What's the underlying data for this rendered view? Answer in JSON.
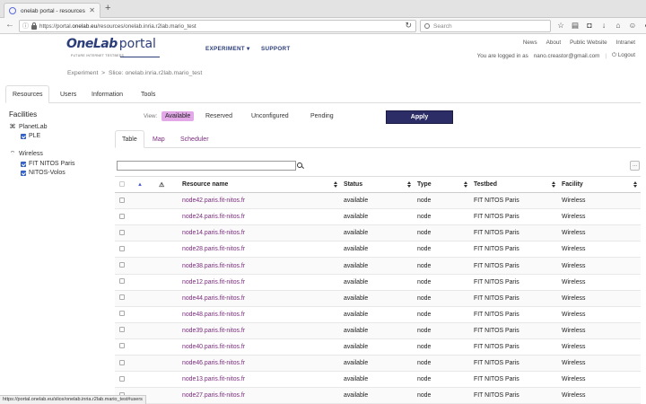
{
  "browser": {
    "tab_title": "onelab portal - resources",
    "url_scheme": "https://portal.",
    "url_domain": "onelab.eu",
    "url_path": "/resources/onelab.inria.r2lab.mario_test",
    "search_placeholder": "Search",
    "status_url": "https://portal.onelab.eu/slice/onelab.inria.r2lab.mario_test#users"
  },
  "header": {
    "logo_main": "OneLab",
    "logo_sub": "portal",
    "logo_tagline": "FUTURE INTERNET TESTBEDS",
    "menu_experiment": "EXPERIMENT",
    "menu_support": "SUPPORT",
    "links": [
      "News",
      "About",
      "Public Website",
      "Intranet"
    ],
    "logged_in_label": "You are logged in as",
    "user_email": "nano.creastor@gmail.com",
    "logout_label": "Logout"
  },
  "breadcrumb": {
    "root": "Experiment",
    "separator": ">",
    "current": "Slice: onelab.inria.r2lab.mario_test"
  },
  "page_tabs": [
    "Resources",
    "Users",
    "Information",
    "Tools"
  ],
  "facilities": {
    "title": "Facilities",
    "groups": [
      {
        "name": "PlanetLab",
        "icon": "planetlab-icon",
        "items": [
          {
            "label": "PLE",
            "checked": true
          }
        ]
      },
      {
        "name": "Wireless",
        "icon": "wifi-icon",
        "items": [
          {
            "label": "FIT NITOS Paris",
            "checked": true
          },
          {
            "label": "NITOS-Volos",
            "checked": true
          }
        ]
      }
    ]
  },
  "view": {
    "label": "View:",
    "options": [
      "Available",
      "Reserved",
      "Unconfigured",
      "Pending"
    ],
    "active": "Available",
    "apply_label": "Apply"
  },
  "sub_tabs": [
    "Table",
    "Map",
    "Scheduler"
  ],
  "table": {
    "more_label": "...",
    "columns": [
      "Resource name",
      "Status",
      "Type",
      "Testbed",
      "Facility"
    ],
    "rows": [
      [
        "node42.paris.fit-nitos.fr",
        "available",
        "node",
        "FIT NITOS Paris",
        "Wireless"
      ],
      [
        "node24.paris.fit-nitos.fr",
        "available",
        "node",
        "FIT NITOS Paris",
        "Wireless"
      ],
      [
        "node14.paris.fit-nitos.fr",
        "available",
        "node",
        "FIT NITOS Paris",
        "Wireless"
      ],
      [
        "node28.paris.fit-nitos.fr",
        "available",
        "node",
        "FIT NITOS Paris",
        "Wireless"
      ],
      [
        "node38.paris.fit-nitos.fr",
        "available",
        "node",
        "FIT NITOS Paris",
        "Wireless"
      ],
      [
        "node12.paris.fit-nitos.fr",
        "available",
        "node",
        "FIT NITOS Paris",
        "Wireless"
      ],
      [
        "node44.paris.fit-nitos.fr",
        "available",
        "node",
        "FIT NITOS Paris",
        "Wireless"
      ],
      [
        "node48.paris.fit-nitos.fr",
        "available",
        "node",
        "FIT NITOS Paris",
        "Wireless"
      ],
      [
        "node39.paris.fit-nitos.fr",
        "available",
        "node",
        "FIT NITOS Paris",
        "Wireless"
      ],
      [
        "node40.paris.fit-nitos.fr",
        "available",
        "node",
        "FIT NITOS Paris",
        "Wireless"
      ],
      [
        "node46.paris.fit-nitos.fr",
        "available",
        "node",
        "FIT NITOS Paris",
        "Wireless"
      ],
      [
        "node13.paris.fit-nitos.fr",
        "available",
        "node",
        "FIT NITOS Paris",
        "Wireless"
      ],
      [
        "node27.paris.fit-nitos.fr",
        "available",
        "node",
        "FIT NITOS Paris",
        "Wireless"
      ]
    ]
  }
}
